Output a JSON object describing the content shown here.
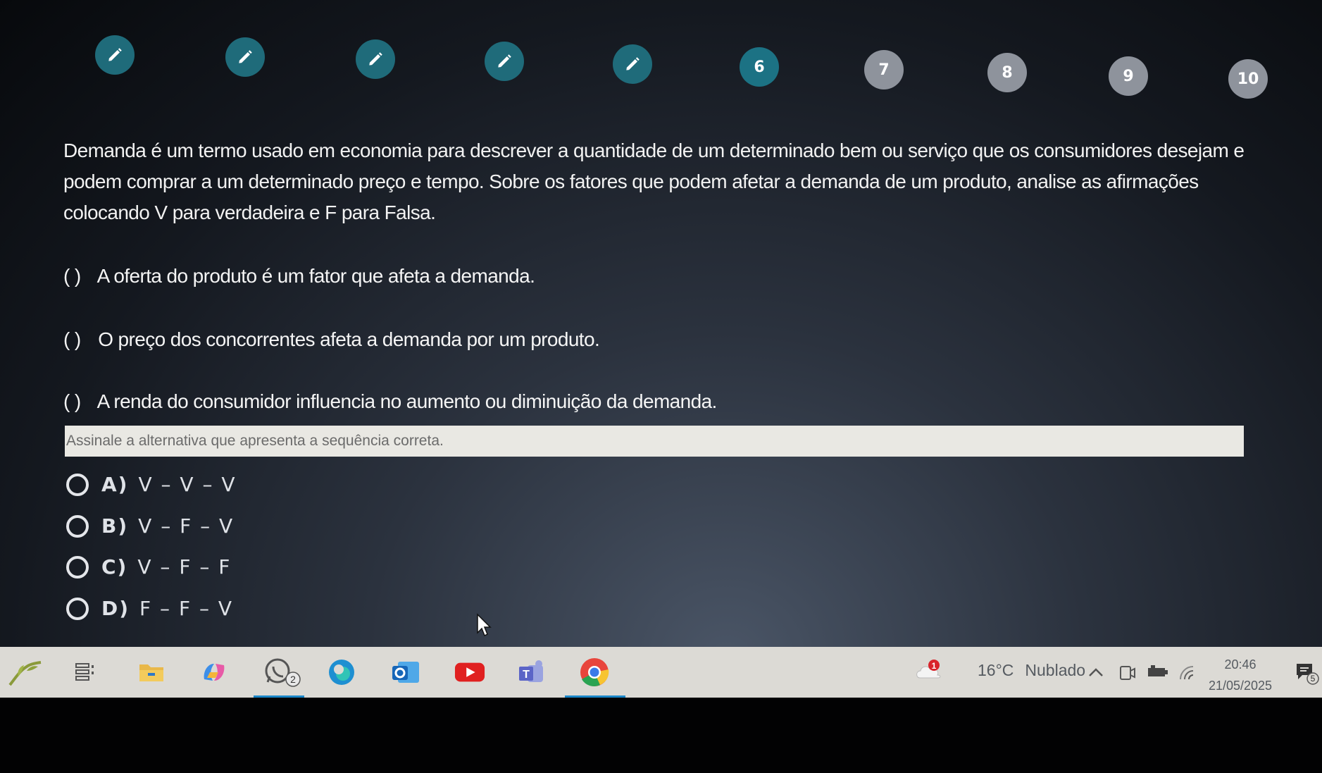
{
  "steps": [
    {
      "label": "",
      "state": "done",
      "icon": "pencil-icon"
    },
    {
      "label": "",
      "state": "done",
      "icon": "pencil-icon"
    },
    {
      "label": "",
      "state": "done",
      "icon": "pencil-icon"
    },
    {
      "label": "",
      "state": "done",
      "icon": "pencil-icon"
    },
    {
      "label": "",
      "state": "done",
      "icon": "pencil-icon"
    },
    {
      "label": "6",
      "state": "current"
    },
    {
      "label": "7",
      "state": "todo"
    },
    {
      "label": "8",
      "state": "todo"
    },
    {
      "label": "9",
      "state": "todo"
    },
    {
      "label": "10",
      "state": "todo"
    }
  ],
  "question": {
    "text": "Demanda é um termo usado em economia para descrever a quantidade de um determinado bem ou serviço que os consumidores desejam e podem comprar a um determinado preço e tempo. Sobre os fatores que podem afetar a demanda de um produto, analise as afirmações colocando V para verdadeira e F para Falsa."
  },
  "statements": [
    {
      "paren": "(   )",
      "text": "A oferta do produto é um fator que afeta a demanda."
    },
    {
      "paren": "(   )",
      "text": "O preço dos concorrentes afeta a demanda por um produto."
    },
    {
      "paren": "(   )",
      "text": "A renda do consumidor influencia no aumento ou diminuição da demanda."
    }
  ],
  "prompt": "Assinale a alternativa que apresenta a sequência correta.",
  "options": [
    {
      "letter": "A)",
      "value": "V – V – V"
    },
    {
      "letter": "B)",
      "value": "V – F – V"
    },
    {
      "letter": "C)",
      "value": "V – F – F"
    },
    {
      "letter": "D)",
      "value": "F – F – V"
    }
  ],
  "taskbar": {
    "whatsapp_badge": "2",
    "weather_alert": "1",
    "temperature": "16°C",
    "condition": "Nublado",
    "time": "20:46",
    "date": "21/05/2025",
    "notification_count": "5"
  },
  "colors": {
    "step_done": "#1f6b7a",
    "step_todo": "#8e939c",
    "taskbar": "#dcdad5",
    "accent": "#1a86c8"
  }
}
